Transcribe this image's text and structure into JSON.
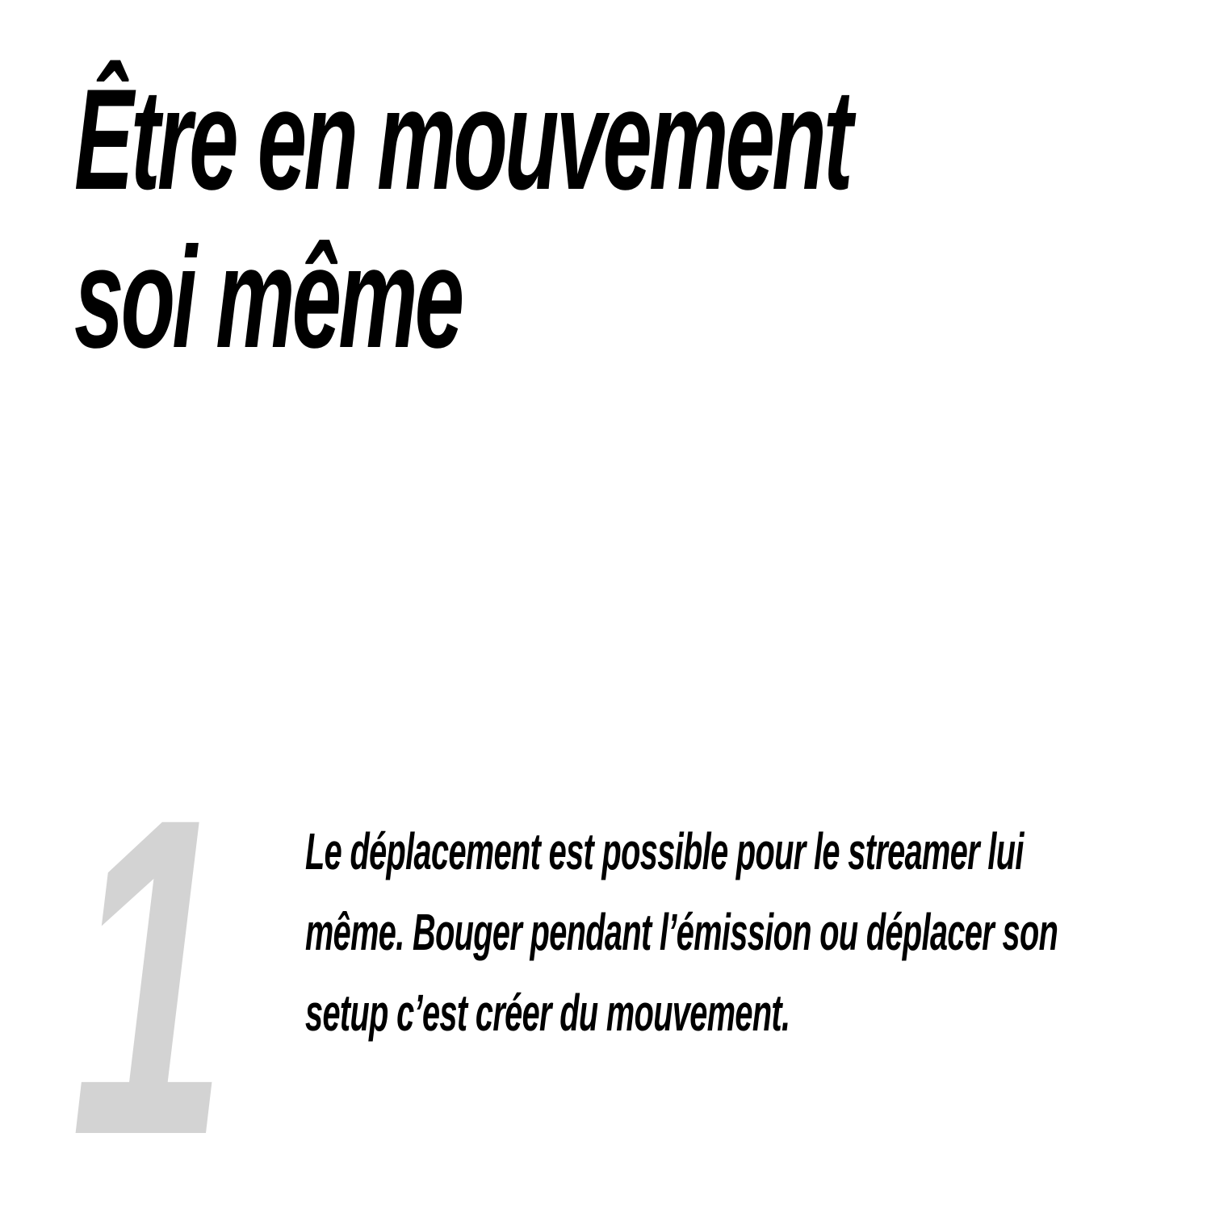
{
  "title": {
    "line1": "Être en mouvement",
    "line2": "soi même"
  },
  "step": {
    "number": "1",
    "text_lines": [
      "Le déplacement est possible pour le streamer lui",
      "même. Bouger pendant l’émission ou déplacer son",
      "setup c’est créer du mouvement."
    ]
  },
  "colors": {
    "text": "#000000",
    "number": "#d3d3d3",
    "background": "#ffffff"
  }
}
